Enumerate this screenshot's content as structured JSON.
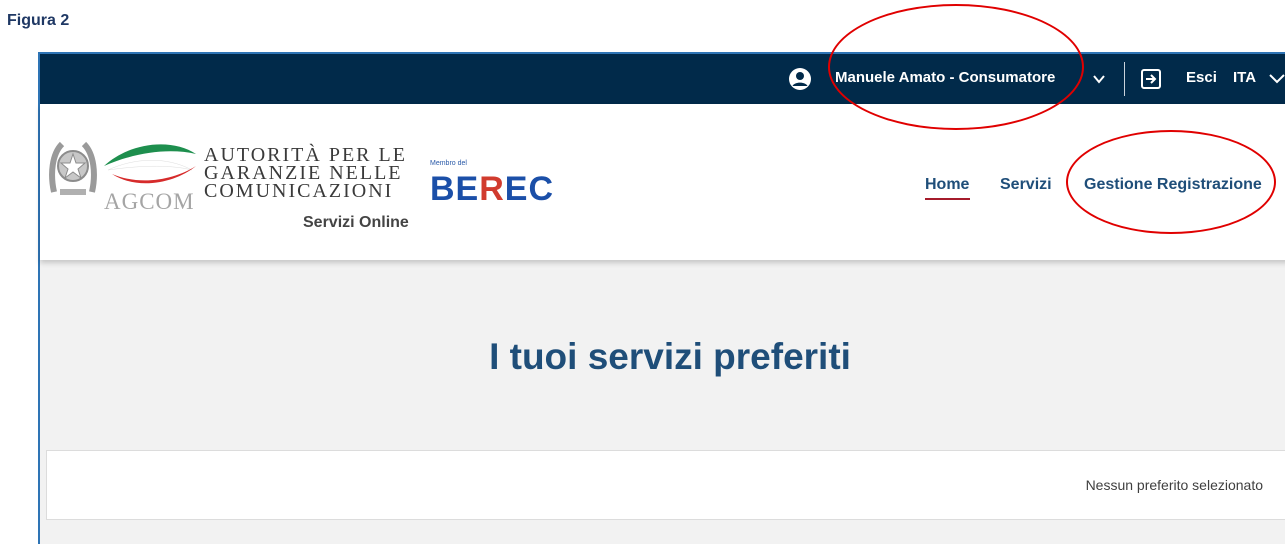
{
  "figure_label": "Figura 2",
  "topbar": {
    "user_icon": "user-circle-icon",
    "user_name": "Manuele Amato - Consumatore",
    "user_menu_icon": "chevron-down-icon",
    "exit_icon": "sign-out-icon",
    "exit_label": "Esci",
    "language": "ITA",
    "language_menu_icon": "chevron-down-icon"
  },
  "header": {
    "authority_lines": [
      "AUTORITÀ PER LE",
      "GARANZIE NELLE",
      "COMUNICAZIONI"
    ],
    "agcom_text": "AGCOM",
    "service_name": "Servizi Online",
    "berec_caption": "Membro del",
    "berec_logo": "BEREC"
  },
  "nav": {
    "items": [
      {
        "label": "Home",
        "active": true
      },
      {
        "label": "Servizi",
        "active": false
      },
      {
        "label": "Gestione Registrazione",
        "active": false
      }
    ]
  },
  "main": {
    "title": "I tuoi servizi preferiti",
    "favorites_empty": "Nessun preferito selezionato"
  },
  "colors": {
    "topbar_bg": "#012a4a",
    "title_color": "#1f4e79",
    "active_underline": "#a51b2b",
    "annotation_red": "#e00000",
    "frame_border": "#2e74b5"
  }
}
